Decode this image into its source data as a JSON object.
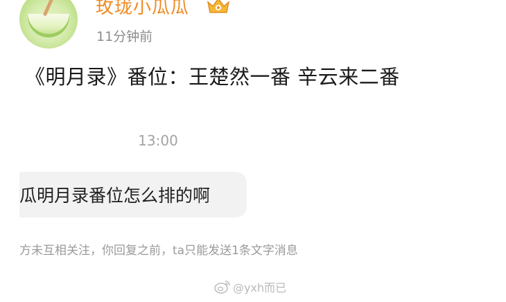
{
  "post": {
    "author": "玫珑小瓜瓜",
    "time": "11分钟前",
    "text": "《明月录》番位：王楚然一番 辛云来二番"
  },
  "chat": {
    "time": "13:00",
    "message": "瓜明月录番位怎么排的啊",
    "notice": "方未互相关注，你回复之前，ta只能发送1条文字消息"
  },
  "watermark": {
    "text": "@yxh而已"
  },
  "colors": {
    "username": "#f08a22",
    "meta_gray": "#8c8c8c",
    "bubble_bg": "#f2f2f2"
  }
}
